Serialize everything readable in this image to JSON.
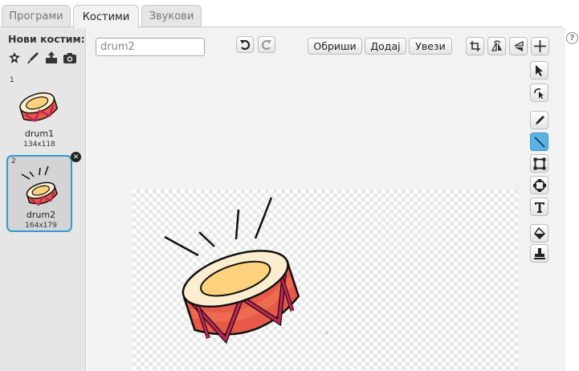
{
  "tabs": {
    "scripts": "Програми",
    "costumes": "Костими",
    "sounds": "Звукови"
  },
  "sidebar": {
    "new_costume_label": "Нови костим:",
    "new_icons": [
      "sprite-library-icon",
      "paint-brush-icon",
      "upload-icon",
      "camera-icon"
    ],
    "costumes": [
      {
        "number": "1",
        "name": "drum1",
        "size": "134x118",
        "selected": false
      },
      {
        "number": "2",
        "name": "drum2",
        "size": "164x179",
        "selected": true
      }
    ]
  },
  "editor": {
    "costume_name_value": "drum2",
    "buttons": {
      "clear": "Обриши",
      "add": "Додај",
      "import": "Увези"
    },
    "top_icons": [
      "undo-icon",
      "redo-icon",
      "crop-icon",
      "flip-horizontal-icon",
      "flip-vertical-icon",
      "set-center-icon"
    ],
    "tools": [
      "select-icon",
      "reshape-icon",
      "pencil-icon",
      "line-icon",
      "rectangle-icon",
      "ellipse-icon",
      "text-icon",
      "fill-icon",
      "stamp-icon"
    ],
    "active_tool": "line-icon"
  },
  "help_label": "?",
  "colors": {
    "accent": "#2f9cd2",
    "drum_body": "#e8594a",
    "drum_stripe": "#c22454",
    "drum_top": "#fde3a0"
  }
}
